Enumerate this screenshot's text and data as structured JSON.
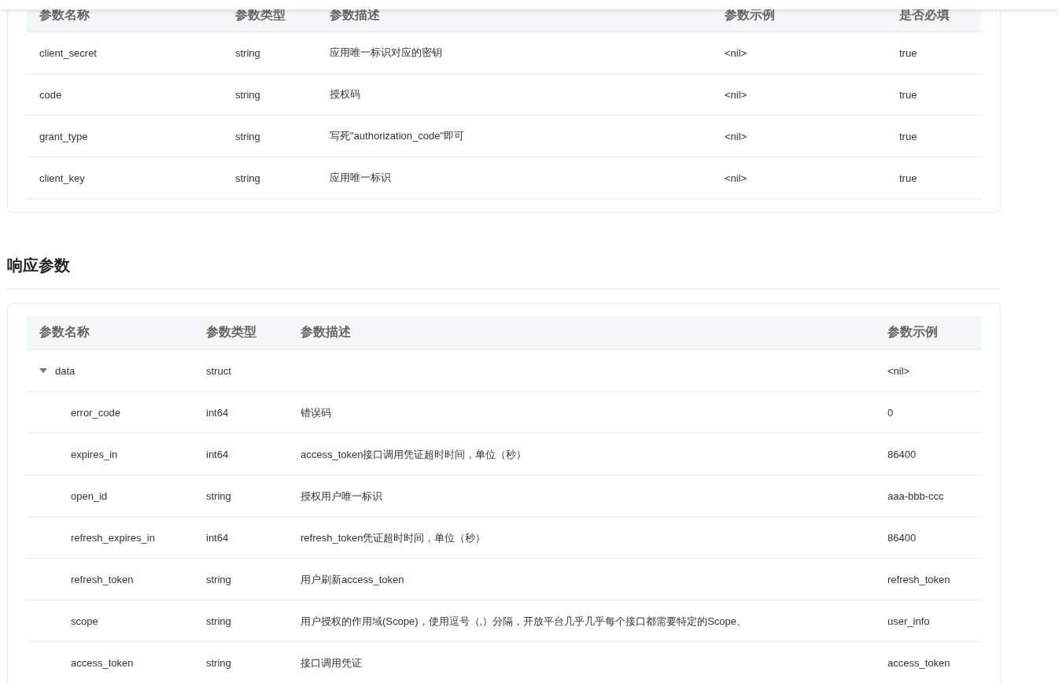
{
  "request_table": {
    "columns": [
      "参数名称",
      "参数类型",
      "参数描述",
      "参数示例",
      "是否必填"
    ],
    "rows": [
      {
        "name": "client_secret",
        "type": "string",
        "description": "应用唯一标识对应的密钥",
        "example": "<nil>",
        "required": "true"
      },
      {
        "name": "code",
        "type": "string",
        "description": "授权码",
        "example": "<nil>",
        "required": "true"
      },
      {
        "name": "grant_type",
        "type": "string",
        "description": "写死\"authorization_code\"即可",
        "example": "<nil>",
        "required": "true"
      },
      {
        "name": "client_key",
        "type": "string",
        "description": "应用唯一标识",
        "example": "<nil>",
        "required": "true"
      }
    ]
  },
  "response_section": {
    "title": "响应参数"
  },
  "response_table": {
    "columns": [
      "参数名称",
      "参数类型",
      "参数描述",
      "参数示例"
    ],
    "rows": [
      {
        "name": "data",
        "type": "struct",
        "example": "<nil>",
        "expanded": true,
        "children": [
          {
            "name": "error_code",
            "type": "int64",
            "description": "错误码",
            "example": "0"
          },
          {
            "name": "expires_in",
            "type": "int64",
            "description": "access_token接口调用凭证超时时间，单位（秒）",
            "example": "86400"
          },
          {
            "name": "open_id",
            "type": "string",
            "description": "授权用户唯一标识",
            "example": "aaa-bbb-ccc"
          },
          {
            "name": "refresh_expires_in",
            "type": "int64",
            "description": "refresh_token凭证超时时间，单位（秒）",
            "example": "86400"
          },
          {
            "name": "refresh_token",
            "type": "string",
            "description": "用户刷新access_token",
            "example": "refresh_token"
          },
          {
            "name": "scope",
            "type": "string",
            "description": "用户授权的作用域(Scope)，使用逗号（,）分隔，开放平台几乎几乎每个接口都需要特定的Scope。",
            "example": "user_info"
          },
          {
            "name": "access_token",
            "type": "string",
            "description": "接口调用凭证",
            "example": "access_token"
          }
        ]
      }
    ]
  }
}
